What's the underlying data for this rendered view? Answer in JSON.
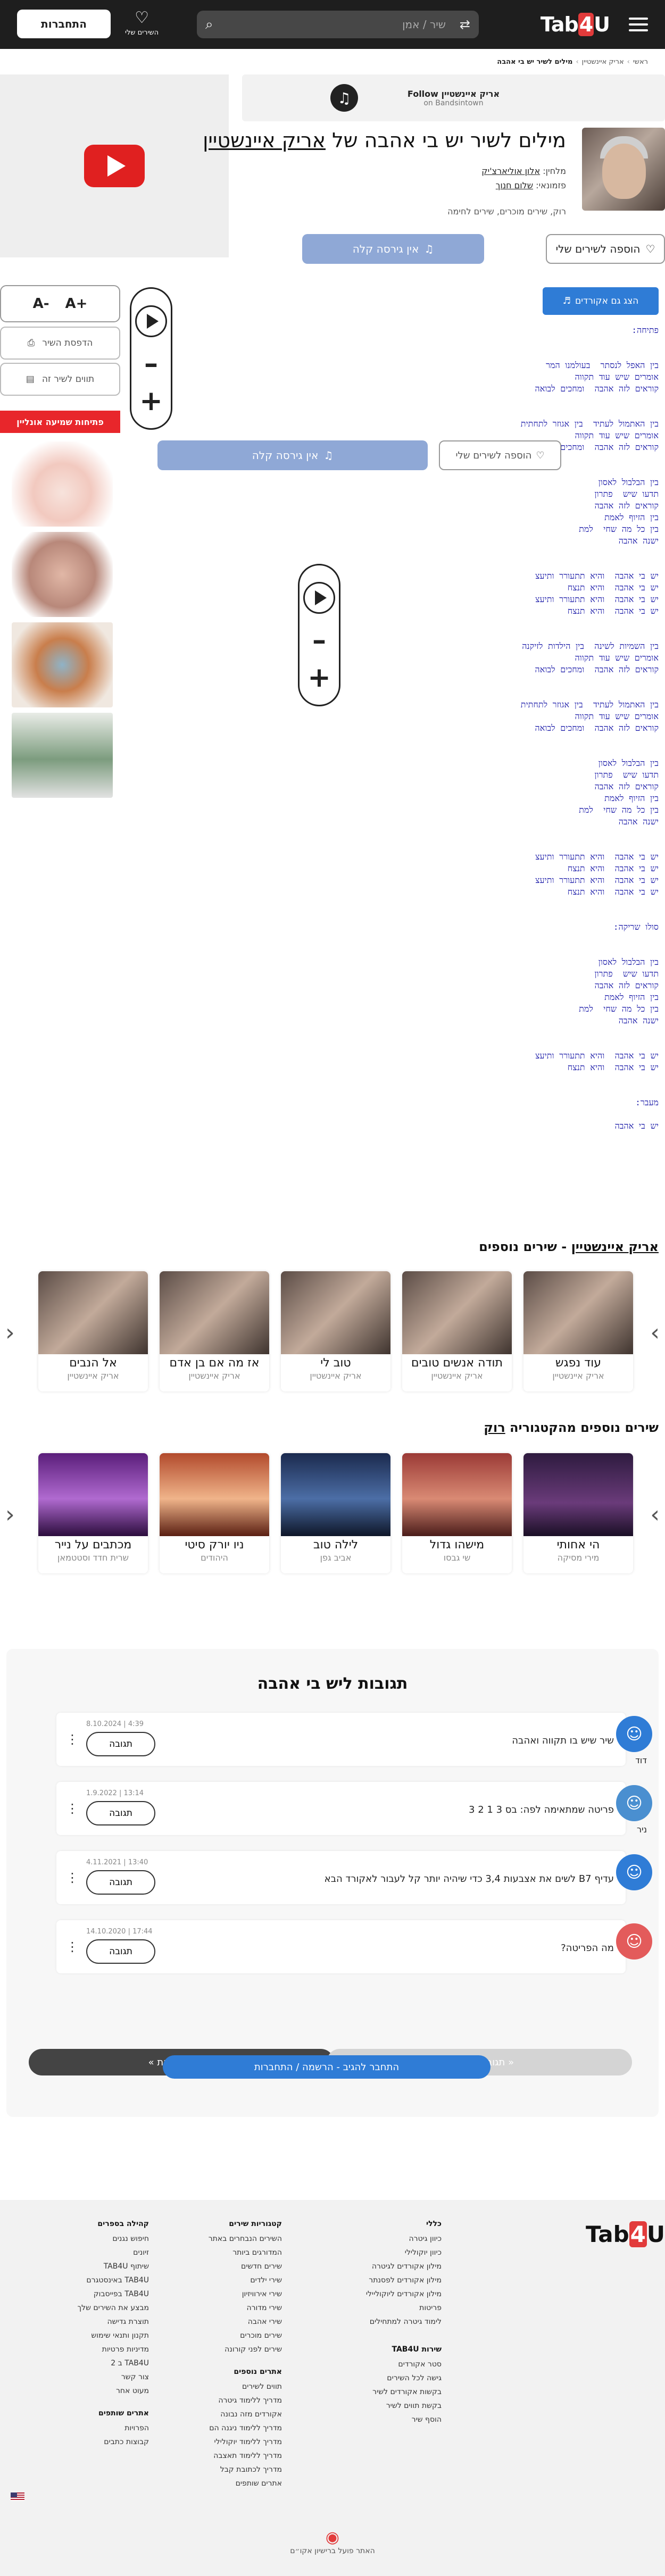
{
  "header": {
    "logo_main": "Tab",
    "logo_four": "4",
    "logo_end": "U",
    "search_placeholder": "שיר / אמן",
    "favorites_label": "השירים שלי",
    "login_button": "התחברות"
  },
  "breadcrumb": [
    "ראשי",
    "אריק איינשטיין",
    "מילים לשיר יש בי אהבה"
  ],
  "bandsintown": {
    "title": "אריק איינשטיין Follow",
    "subtitle": "on Bandsintown"
  },
  "song": {
    "title_prefix": "מילים לשיר יש בי אהבה של",
    "artist": "אריק איינשטיין",
    "composer_label": "מלחין:",
    "composer": "אלון אוליארצ'יק",
    "lyricist_label": "פזמונאי:",
    "lyricist": "שלום חנוך",
    "tags": [
      "רוק",
      "שירים מוכרים",
      "שירים לחימה"
    ]
  },
  "buttons": {
    "add_to_my_songs": "הוספה לשירים שלי",
    "no_easy_version": "אין גירסה קלה",
    "show_with_chords": "הצג גם אקורדים",
    "zoom_plus": "+A",
    "zoom_minus": "-A",
    "print_song": "הדפסת השיר",
    "song_credits": "תווים לשיר זה",
    "recording_tab": "פתיחות שמיעה אונליין"
  },
  "lyrics_text": "פתיחה:\n\n\nבין האפל לנסתר  בעולמנו המר\nאומרים שיש עוד תקווה\nקוראים לזה אהבה  ומחכים לבואה\n\n\nבין האתמול לעתיד  בין אגוזר לתחתית\nאומרים שיש עוד תקווה\nקוראים לזה אהבה  ומחכים לבואה\n\n\nבין הבלבול לאסון\nתדעו שיש  פתרון\nקוראים לזה אהבה\nבין הזיוף לאמת\nבין כל מה שחי  למת\nישנה אהבה\n\n\nיש בי אהבה  והיא תתעורר ותיעצ\nיש בי אהבה  והיא תנצח\nיש בי אהבה  והיא תתעורר ותיעצ\nיש בי אהבה  והיא תנצח\n\n\nבין השמיות לשינה  בין הילדות לזיקנה\nאומרים שיש עוד תקווה\nקוראים לזה אהבה  ומחכים לבואה\n\n\nבין האתמול לעתיד  בין אגוזר לתחתית\nאומרים שיש עוד תקווה\nקוראים לזה אהבה  ומחכים לבואה\n\n\nבין הבלבול לאסון\nתדעו שיש  פתרון\nקוראים לזה אהבה\nבין הזיוף לאמת\nבין כל מה שחי  למת\nישנה אהבה\n\n\nיש בי אהבה  והיא תתעורר ותיעצ\nיש בי אהבה  והיא תנצח\nיש בי אהבה  והיא תתעורר ותיעצ\nיש בי אהבה  והיא תנצח\n\n\nסולו שריקה:\n\n\nבין הבלבול לאסון\nתדעו שיש  פתרון\nקוראים לזה אהבה\nבין הזיוף לאמת\nבין כל מה שחי  למת\nישנה אהבה\n\n\nיש בי אהבה  והיא תתעורר ותיעצ\nיש בי אהבה  והיא תנצח\n\n\nמעבר:\n\nיש בי אהבה",
  "more_songs": {
    "title_artist": "אריק איינשטיין",
    "title_suffix": " - שירים נוספים",
    "items": [
      {
        "title": "עוד נפגש",
        "artist": "אריק איינשטיין"
      },
      {
        "title": "תודה אנשים טובים",
        "artist": "אריק איינשטיין"
      },
      {
        "title": "טוב לי",
        "artist": "אריק איינשטיין"
      },
      {
        "title": "אז מה אם בן אדם",
        "artist": "אריק איינשטיין"
      },
      {
        "title": "אל הנבים",
        "artist": "אריק איינשטיין"
      }
    ]
  },
  "category_songs": {
    "title_prefix": "שירים נוספים מהקטגוריה ",
    "title_category": "רוק",
    "items": [
      {
        "title": "הי אחותי",
        "artist": "מירי מסיקה"
      },
      {
        "title": "מישהו גדול",
        "artist": "שי גבסו"
      },
      {
        "title": "לילה טוב",
        "artist": "אביב גפן"
      },
      {
        "title": "ניו יורק סיטי",
        "artist": "היהודים"
      },
      {
        "title": "מכתבים על נייר",
        "artist": "שרית חדד וסטטמאן"
      }
    ]
  },
  "comments": {
    "title": "תגובות ליש בי אהבה",
    "reply_label": "תגובה",
    "items": [
      {
        "name": "דוד",
        "date": "4:39 | 8.10.2024",
        "text": "שיר שיש בו תקווה ואהבה",
        "color": "#2f7cd6"
      },
      {
        "name": "ניר",
        "date": "13:14 | 1.9.2022",
        "text": "פריטה שמתאימה לפה: בס 3 1 2 3",
        "color": "#4a8fd0"
      },
      {
        "name": "",
        "date": "13:40 | 4.11.2021",
        "text": "עדיף B7 לשים את אצבעות 3,4 כדי שיהיה יותר קל לעבור לאקורד הבא",
        "color": "#2f7cd6"
      },
      {
        "name": "",
        "date": "17:44 | 14.10.2020",
        "text": "מה הפריטה?",
        "color": "#e35b5b"
      }
    ],
    "next_label": "תגובות הבאות »",
    "prev_label": "« תגובות קודמות",
    "login_cta": "התחבר להגיב - הרשמה / התחברות"
  },
  "footer": {
    "col1_head": "כללי",
    "col1": [
      "כיוון גיטרה",
      "כיוון יוקולילי",
      "מילון אקורדים לגיטרה",
      "מילון אקורדים לפסנתר",
      "מילון אקורדים ליוקוליילי",
      "פריטות",
      "לימוד גיטרה למתחילים"
    ],
    "col1b_head": "שירות TAB4U",
    "col1b": [
      "סטר אקורדים",
      "גישה לכל השירים",
      "בקשות אקורדים לשיר",
      "בקשת תווים לשיר",
      "הוסף שיר"
    ],
    "col2_head": "קטגוריות שירים",
    "col2": [
      "השירים הנבחרים באתר",
      "המדורגים ביותר",
      "שירים חדשים",
      "שירי ילדים",
      "שירי אירוויזיון",
      "שירי מדורה",
      "שירי אהבה",
      "שירים מוכרים",
      "שירים לפני קורונה"
    ],
    "col2b_head": "אתרים נוספים",
    "col2b": [
      "תווים לשירים",
      "מדריך ללימוד גיטרה",
      "אקורדים מזה נבונה",
      "מדריך ללימוד ניגנה הם",
      "מדריך ללימוד יוקולילי",
      "מדריך ללימוד תאצבה",
      "מדריך לכתובת קבל",
      "אתרים שותפים"
    ],
    "col3_head": "קהילה בספרים",
    "col3": [
      "חיפוש נגנים",
      "זיונים",
      "שיתוף TAB4U",
      "TAB4U באינסטגרם",
      "TAB4U בפייסבוק",
      "מבצע את השירים שלך",
      "תוצרת גדישה",
      "תקנון ותנאי שימוש",
      "מדיניות פרטיות",
      "TAB4U ב 2",
      "צור קשר",
      "מעוט אחר"
    ],
    "col3b_head": "אתרים שותפים",
    "col3b": [
      "הפרויות",
      "קבוצות כתבים"
    ],
    "made_label": "האתר פועל ברישיון אקו״ם"
  }
}
